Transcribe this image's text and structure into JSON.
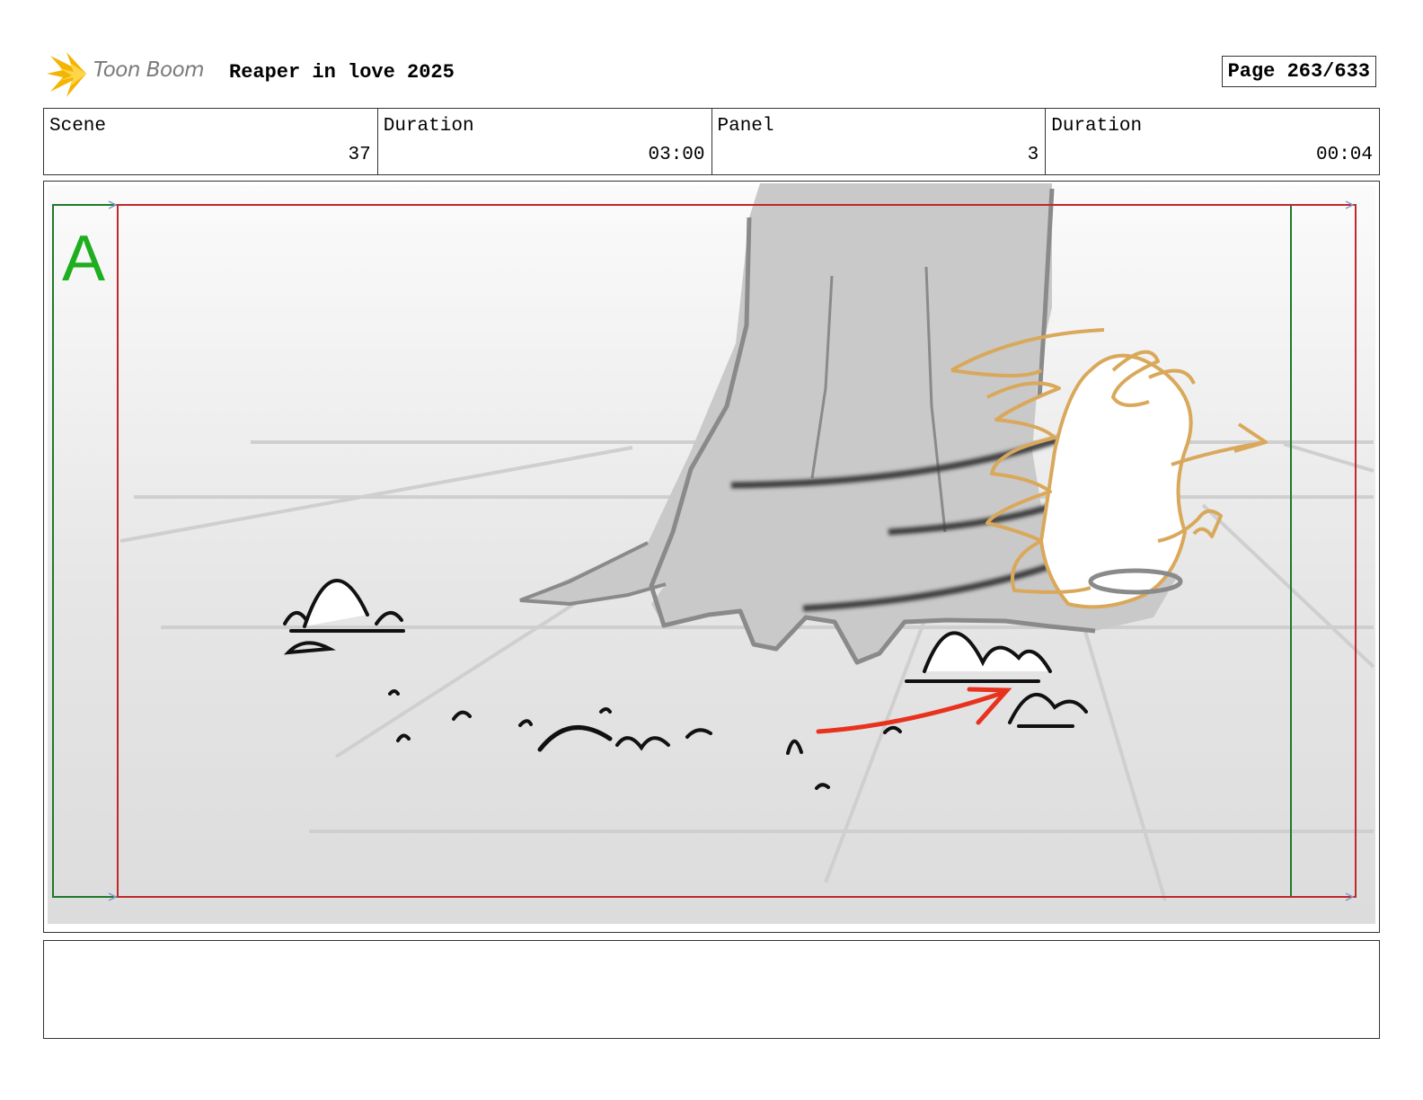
{
  "header": {
    "logo_text": "Toon Boom",
    "project_title": "Reaper in love 2025",
    "page_label": "Page 263/633"
  },
  "info": {
    "scene_label": "Scene",
    "scene_value": "37",
    "scene_duration_label": "Duration",
    "scene_duration_value": "03:00",
    "panel_label": "Panel",
    "panel_value": "3",
    "panel_duration_label": "Duration",
    "panel_duration_value": "00:04"
  },
  "panel": {
    "camera_label": "A",
    "colors": {
      "camera_frame": "#c0282a",
      "safe_frame": "#1f7a2a",
      "camera_letter": "#1fae1f",
      "motion_arrow": "#e8321e",
      "character_outline": "#d9a85a",
      "tree": "#c9c9c9"
    }
  },
  "notes": {
    "text": ""
  }
}
